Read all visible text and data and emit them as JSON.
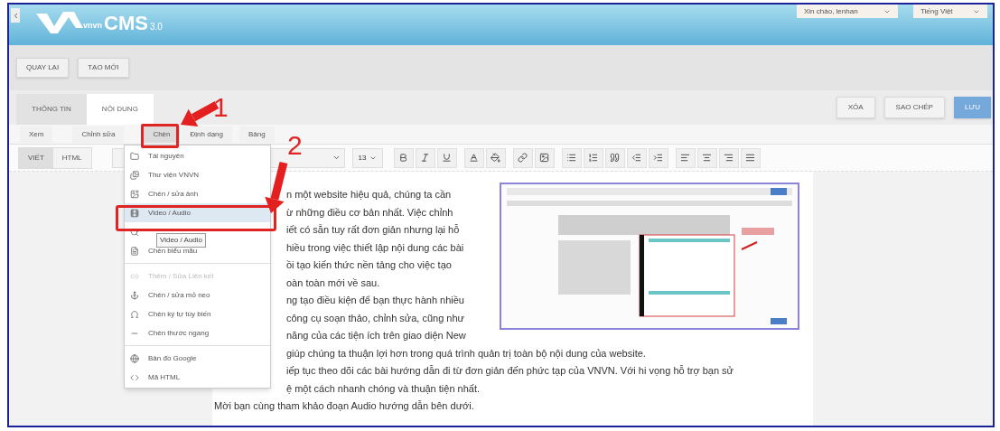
{
  "header": {
    "logo": {
      "brand": "vnvn",
      "product": "CMS",
      "version": "3.0"
    },
    "user_menu": "Xin chào, lenhan",
    "language": "Tiếng Việt"
  },
  "action_bar": [
    "QUAY LẠI",
    "TẠO MỚI"
  ],
  "tabs": [
    {
      "label": "THÔNG TIN",
      "selected": false
    },
    {
      "label": "NỘI DUNG",
      "selected": true
    }
  ],
  "tab_actions": [
    {
      "label": "XÓA",
      "kind": "default"
    },
    {
      "label": "SAO CHÉP",
      "kind": "default"
    },
    {
      "label": "LƯU",
      "kind": "primary"
    }
  ],
  "menu_bar": [
    {
      "label": "Xem",
      "selected": false
    },
    {
      "label": "Chỉnh sửa",
      "selected": false
    },
    {
      "label": "Chèn",
      "selected": true
    },
    {
      "label": "Định dạng",
      "selected": false
    },
    {
      "label": "Bảng",
      "selected": false
    }
  ],
  "editor_toolbar": {
    "modes": [
      {
        "label": "VIẾT",
        "selected": true
      },
      {
        "label": "HTML",
        "selected": false
      }
    ],
    "font_size": "13"
  },
  "insert_menu": {
    "items": [
      {
        "kind": "item",
        "label": "Tài nguyên",
        "disabled": false,
        "selected": false
      },
      {
        "kind": "item",
        "label": "Thư viện VNVN",
        "disabled": false,
        "selected": false
      },
      {
        "kind": "item",
        "label": "Chèn / sửa ảnh",
        "disabled": false,
        "selected": false
      },
      {
        "kind": "item",
        "label": "Video / Audio",
        "disabled": false,
        "selected": true
      },
      {
        "kind": "covered",
        "tooltip": "Video / Audio"
      },
      {
        "kind": "item",
        "label": "Chèn biểu mẫu",
        "disabled": false,
        "selected": false
      },
      {
        "kind": "divider"
      },
      {
        "kind": "item",
        "label": "Thêm / Sửa Liên kết",
        "disabled": true,
        "selected": false
      },
      {
        "kind": "item",
        "label": "Chèn / sửa mỏ neo",
        "disabled": false,
        "selected": false
      },
      {
        "kind": "item",
        "label": "Chèn ký tự tùy biến",
        "disabled": false,
        "selected": false
      },
      {
        "kind": "item",
        "label": "Chèn thước ngang",
        "disabled": false,
        "selected": false
      },
      {
        "kind": "divider"
      },
      {
        "kind": "item",
        "label": "Bản đồ Google",
        "disabled": false,
        "selected": false
      },
      {
        "kind": "item",
        "label": "Mã HTML",
        "disabled": false,
        "selected": false
      }
    ]
  },
  "editor": {
    "lines": [
      {
        "kind": "beside_image",
        "text": "n một website hiệu quả, chúng ta cần"
      },
      {
        "kind": "beside_image",
        "text": "ừ những điều cơ bản nhất. Việc chỉnh"
      },
      {
        "kind": "beside_image",
        "text": "iết có sẵn tuy rất đơn giản nhưng lại hỗ"
      },
      {
        "kind": "beside_image",
        "text": "hiều trong việc thiết lập nội dung các bài"
      },
      {
        "kind": "beside_image",
        "text": "ồi tạo kiến thức nền tảng cho việc tạo"
      },
      {
        "kind": "beside_image",
        "text": "oàn toàn mới về sau."
      },
      {
        "kind": "beside_image",
        "text": "ng tạo điều kiện để bạn thực hành nhiều"
      },
      {
        "kind": "beside_image",
        "text": "công cụ soạn thảo, chỉnh sửa, cũng như"
      },
      {
        "kind": "beside_image",
        "text": "năng của các tiện ích trên giao diện New"
      },
      {
        "kind": "below_image",
        "text": "giúp chúng ta thuận lợi hơn trong quá trình quản trị toàn bộ nội dung của website."
      },
      {
        "kind": "below_image",
        "text": "iếp tục theo dõi các bài hướng dẫn đi từ đơn giản đến phức tạp của VNVN. Với hi vọng hỗ trợ bạn sử"
      },
      {
        "kind": "below_image",
        "text": "ệ một cách nhanh chóng và thuận tiện nhất."
      },
      {
        "kind": "uncovered",
        "text": "Mời bạn cùng tham khảo đoạn Audio hướng dẫn bên dưới."
      }
    ]
  },
  "annotations": [
    {
      "label": "1"
    },
    {
      "label": "2"
    }
  ]
}
